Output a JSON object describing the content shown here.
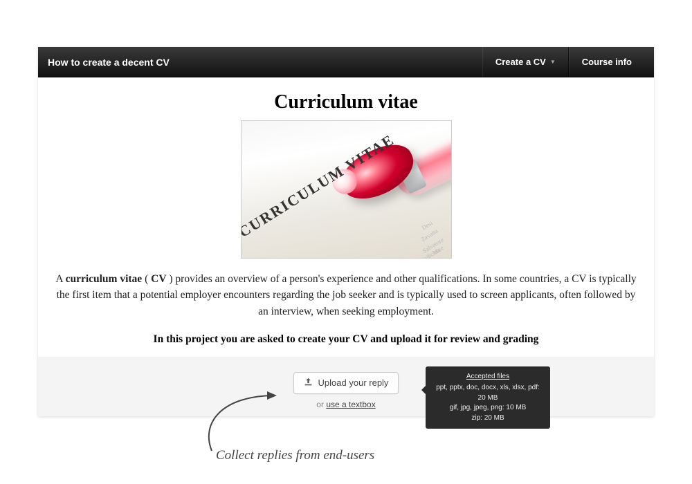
{
  "topbar": {
    "title": "How to create a decent CV",
    "nav1": "Create a CV",
    "nav2": "Course info"
  },
  "content": {
    "heading": "Curriculum vitae",
    "hero_text": "CURRICULUM VITAE",
    "bg1": "Desi",
    "bg2": "Zavatta",
    "bg3": "Salvatore Mu",
    "bg4": "Medicina e",
    "para_pre": "A ",
    "para_b1": "curriculum vitae",
    "para_mid": " ( ",
    "para_b2": "CV",
    "para_post": " ) provides an overview of a person's experience and other qualifications. In some countries, a CV is typically the first item that a potential employer encounters regarding the job seeker and is typically used to screen applicants, often followed by an interview, when seeking employment.",
    "instruction": "In this project you are asked to create your CV and upload it for review and grading"
  },
  "reply": {
    "upload_label": "Upload your reply",
    "alt_prefix": "or ",
    "alt_link": "use a textbox"
  },
  "tooltip": {
    "title": "Accepted files",
    "l1": "ppt, pptx, doc, docx, xls, xlsx, pdf: 20 MB",
    "l2": "gif, jpg, jpeg, png: 10 MB",
    "l3": "zip: 20 MB"
  },
  "annotation": {
    "caption": "Collect replies from end-users"
  }
}
